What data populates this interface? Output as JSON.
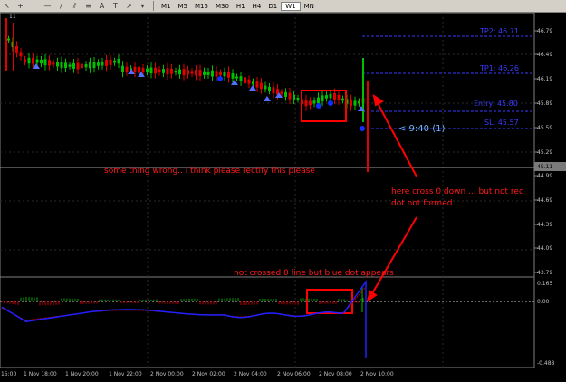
{
  "toolbar": {
    "timeframes": [
      "M1",
      "M5",
      "M15",
      "M30",
      "H1",
      "H4",
      "D1",
      "W1",
      "MN"
    ],
    "active_timeframe": "W1",
    "icons": [
      "pointer-icon",
      "crosshair-icon",
      "vertical-line-icon",
      "horizontal-line-icon",
      "trendline-icon",
      "channel-icon",
      "fibonacci-icon",
      "text-icon",
      "label-icon",
      "arrow-icon",
      "more-icon"
    ]
  },
  "chart": {
    "top_left_label": "11",
    "price_axis": [
      "46.79",
      "46.49",
      "46.19",
      "45.89",
      "45.59",
      "45.29",
      "44.99",
      "44.69",
      "44.39",
      "44.09",
      "43.79"
    ],
    "current_price": "45.11",
    "indicator_axis": [
      "0.165",
      "0.00",
      "-0.488"
    ],
    "time_axis": [
      "15:00",
      "1 Nov 18:00",
      "1 Nov 20:00",
      "1 Nov 22:00",
      "2 Nov 00:00",
      "2 Nov 02:00",
      "2 Nov 04:00",
      "2 Nov 06:00",
      "2 Nov 08:00",
      "2 Nov 10:00"
    ],
    "levels": {
      "tp2": "TP2: 46.71",
      "tp1": "TP1: 46.26",
      "entry": "Entry: 45.80",
      "sl": "SL: 45.57"
    },
    "timer": "< 9:40 (1)"
  },
  "annotations": {
    "main": "some thing wrong.. i think please rectify this please",
    "right": "here cross 0 down ... but not red",
    "right2": "dot not formed...",
    "bottom": "not crossed 0 line but blue dot appears"
  },
  "colors": {
    "background": "#000000",
    "bull_candle": "#00c000",
    "bear_candle": "#e00000",
    "level_line": "#3a3aff",
    "annotation": "#ff1a1a",
    "indicator_main": "#2020ff",
    "indicator_signal": "#c00000"
  }
}
